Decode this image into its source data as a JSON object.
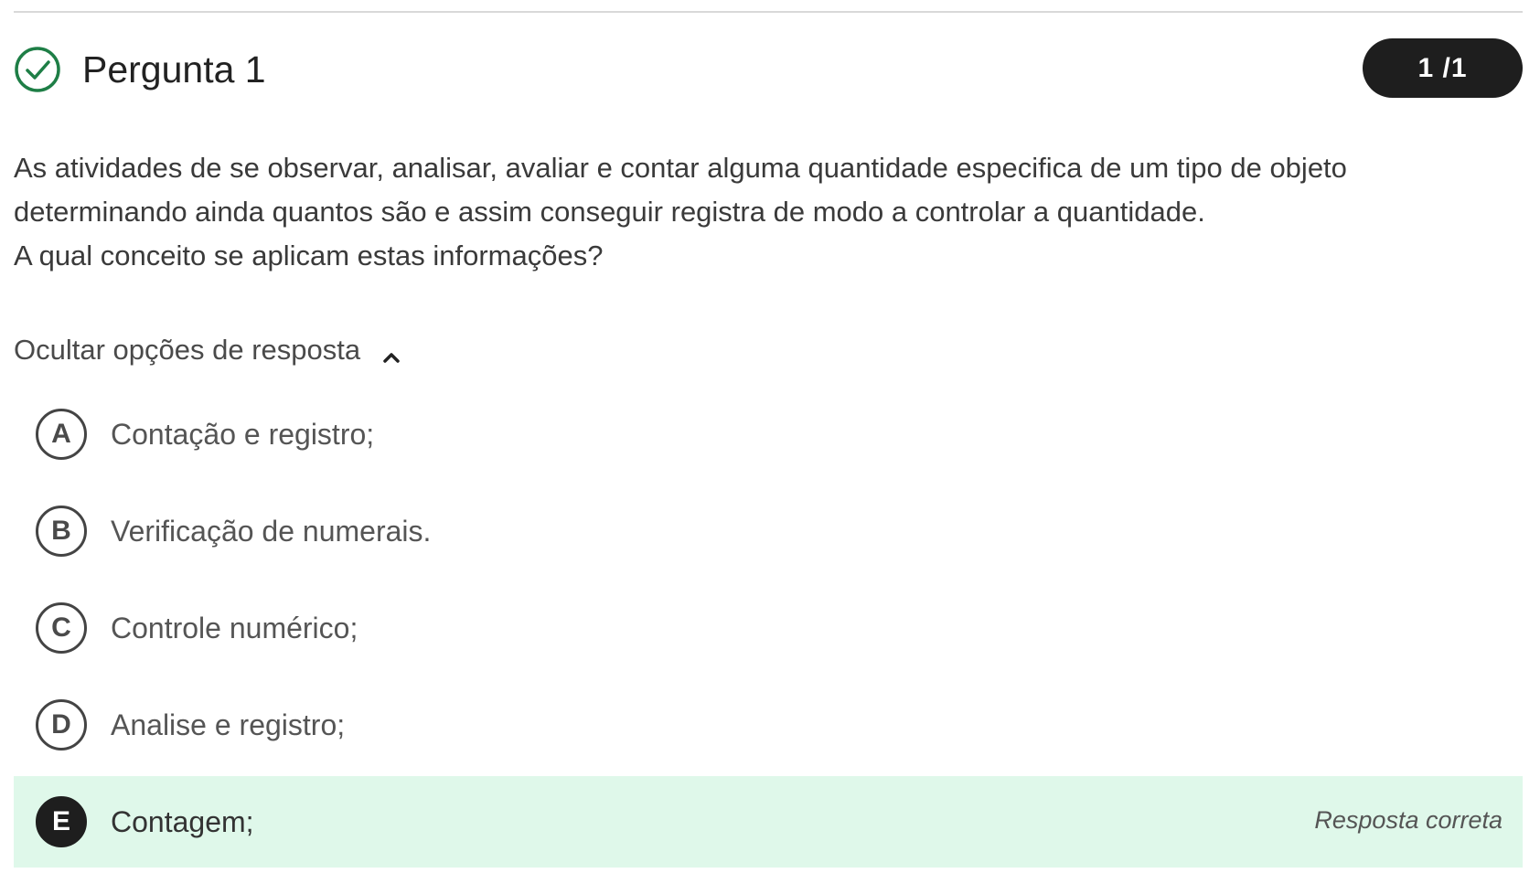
{
  "question": {
    "title": "Pergunta 1",
    "score": "1 /1",
    "status_icon": "check-circle-icon",
    "status_color": "#1e7e46",
    "text_lines": [
      "As atividades de se observar, analisar, avaliar e contar alguma quantidade especifica de um tipo de objeto",
      "determinando ainda quantos são e assim conseguir registra de modo a controlar a quantidade.",
      "A qual conceito se aplicam estas informações?"
    ]
  },
  "answers": {
    "toggle_label": "Ocultar opções de resposta",
    "toggle_icon": "chevron-up-icon",
    "options": [
      {
        "letter": "A",
        "text": "Contação e registro;"
      },
      {
        "letter": "B",
        "text": "Verificação de numerais."
      },
      {
        "letter": "C",
        "text": "Controle numérico;"
      },
      {
        "letter": "D",
        "text": "Analise e registro;"
      },
      {
        "letter": "E",
        "text": "Contagem;",
        "feedback": "Resposta correta"
      }
    ],
    "correct_highlight_color": "#dff8ea"
  }
}
